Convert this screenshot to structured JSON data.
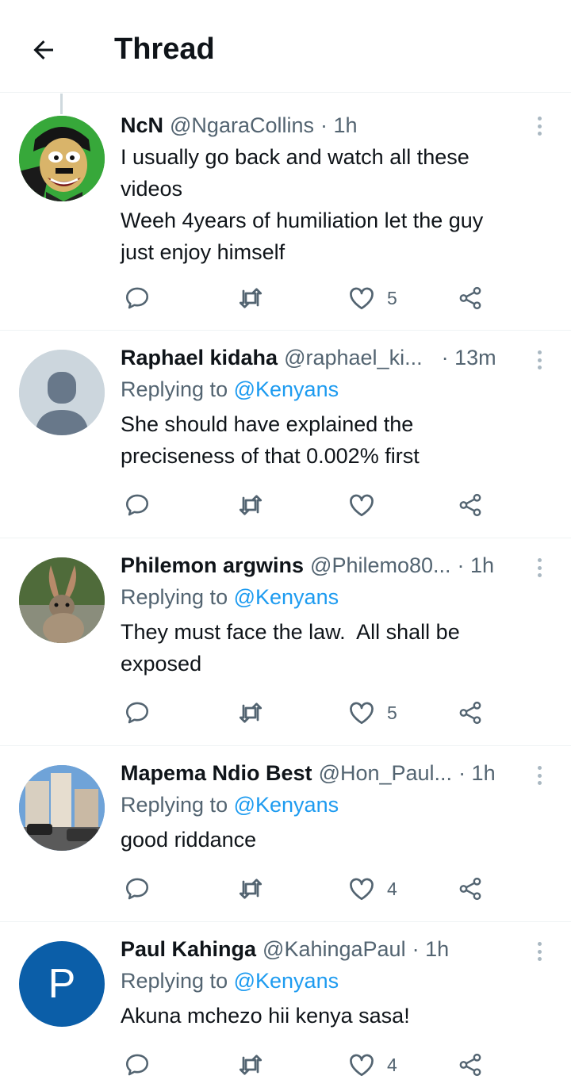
{
  "header": {
    "title": "Thread"
  },
  "tweets": [
    {
      "name": "NcN",
      "handle": "@NgaraCollins",
      "time": "· 1h",
      "replying": "",
      "mention": "",
      "text_lines": [
        "I usually go back and watch all these",
        "videos",
        "Weeh 4years of humiliation let the guy",
        "just enjoy himself"
      ],
      "counts": {
        "reply": "",
        "retweet": "",
        "like": "5"
      },
      "avatar": "cartoon-face"
    },
    {
      "name": "Raphael kidaha",
      "handle": "@raphael_ki...",
      "time": "· 13m",
      "replying": "Replying to",
      "mention": "@Kenyans",
      "text_lines": [
        "She should have explained the",
        "preciseness of that 0.002% first"
      ],
      "counts": {
        "reply": "",
        "retweet": "",
        "like": ""
      },
      "avatar": "default-person"
    },
    {
      "name": "Philemon argwins",
      "handle": "@Philemo80...",
      "time": "· 1h",
      "replying": "Replying to",
      "mention": "@Kenyans",
      "text_lines": [
        "They must face the law.  All shall be",
        "exposed"
      ],
      "counts": {
        "reply": "",
        "retweet": "",
        "like": "5"
      },
      "avatar": "hare-photo"
    },
    {
      "name": "Mapema Ndio Best",
      "handle": "@Hon_Paul...",
      "time": "· 1h",
      "replying": "Replying to",
      "mention": "@Kenyans",
      "text_lines": [
        "good riddance"
      ],
      "counts": {
        "reply": "",
        "retweet": "",
        "like": "4"
      },
      "avatar": "city-photo"
    },
    {
      "name": "Paul Kahinga",
      "handle": "@KahingaPaul",
      "time": "· 1h",
      "replying": "Replying to",
      "mention": "@Kenyans",
      "text_lines": [
        "Akuna mchezo hii kenya sasa!"
      ],
      "counts": {
        "reply": "",
        "retweet": "",
        "like": "4"
      },
      "avatar": "initial",
      "avatar_initial": "P"
    }
  ],
  "colors": {
    "accent": "#1d9bf0",
    "muted": "#536471",
    "initial_avatar": "#0b5ea8"
  }
}
